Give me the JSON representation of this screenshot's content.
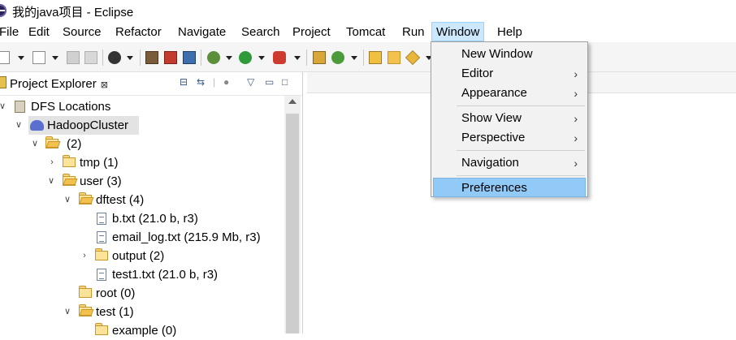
{
  "window": {
    "title": "我的java项目 - Eclipse",
    "icon": "eclipse-logo-icon"
  },
  "menubar": [
    "File",
    "Edit",
    "Source",
    "Refactor",
    "Navigate",
    "Search",
    "Project",
    "Tomcat",
    "Run",
    "Window",
    "Help"
  ],
  "active_menu": "Window",
  "toolbar": {
    "icons": [
      "new-wizard-icon",
      "new-icon",
      "save-icon",
      "save-all-icon",
      "profile-icon",
      "hadoop-icon",
      "hadoop-delete-icon",
      "hadoop-ok-icon",
      "debug-icon",
      "run-icon",
      "external-tools-icon",
      "new-package-icon",
      "new-class-icon",
      "open-type-icon",
      "open-folder-icon",
      "search-icon"
    ]
  },
  "explorer": {
    "tab_label": "Project Explorer",
    "close_glyph": "⊠",
    "tree": [
      {
        "label": "DFS Locations",
        "icon": "dfs-icon"
      },
      {
        "label": "HadoopCluster",
        "icon": "elephant-icon"
      },
      {
        "label": "(2)",
        "icon": "folder-open-icon"
      },
      {
        "label": "tmp (1)",
        "icon": "folder-icon"
      },
      {
        "label": "user (3)",
        "icon": "folder-open-icon"
      },
      {
        "label": "dftest (4)",
        "icon": "folder-open-icon"
      },
      {
        "label": "b.txt (21.0 b, r3)",
        "icon": "file-icon"
      },
      {
        "label": "email_log.txt (215.9 Mb, r3)",
        "icon": "file-icon"
      },
      {
        "label": "output (2)",
        "icon": "folder-icon"
      },
      {
        "label": "test1.txt (21.0 b, r3)",
        "icon": "file-icon"
      },
      {
        "label": "root (0)",
        "icon": "folder-icon"
      },
      {
        "label": "test (1)",
        "icon": "folder-open-icon"
      },
      {
        "label": "example (0)",
        "icon": "folder-icon"
      }
    ]
  },
  "window_menu": {
    "items": [
      {
        "label": "New Window",
        "submenu": false
      },
      {
        "label": "Editor",
        "submenu": true
      },
      {
        "label": "Appearance",
        "submenu": true
      },
      {
        "label": "Show View",
        "submenu": true
      },
      {
        "label": "Perspective",
        "submenu": true
      },
      {
        "label": "Navigation",
        "submenu": true
      },
      {
        "label": "Preferences",
        "submenu": false,
        "highlighted": true
      }
    ],
    "submenu_arrow": "›"
  },
  "colors": {
    "menu_highlight": "#91c9f7",
    "active_menu_bg": "#cce8ff",
    "selection": "#e3e3e3"
  }
}
